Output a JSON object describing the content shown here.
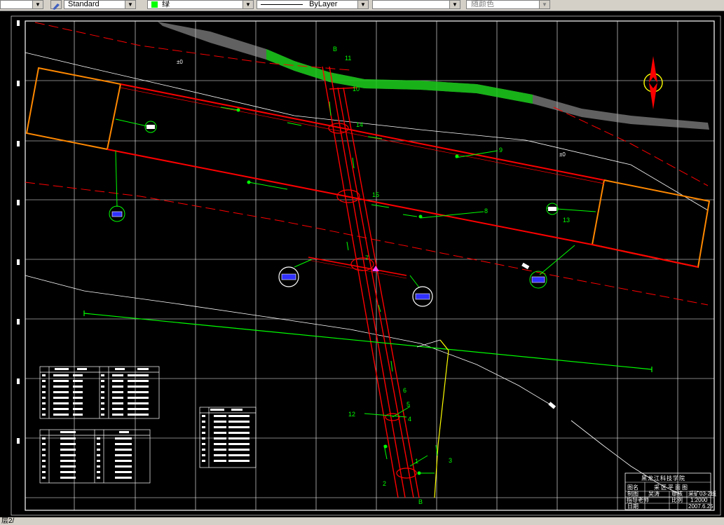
{
  "toolbar": {
    "text_style": "Standard",
    "color_value": "绿",
    "color_swatch": "#00ff00",
    "linetype_value": "ByLayer",
    "lineweight_value": "",
    "plotstyle_value": "随颜色"
  },
  "status": {
    "command_line": "层2/"
  },
  "drawing": {
    "background": "#000000",
    "colors": {
      "mine_line": "#ff0000",
      "annotation": "#00ff00",
      "aux": "#ffff00",
      "grid": "#ffffff",
      "contour": "#ffffff",
      "orange": "#ff8800"
    },
    "elevation_labels": [
      "±0",
      "±0"
    ],
    "point_labels": [
      "B",
      "11",
      "10",
      "14",
      "9",
      "15",
      "8",
      "13",
      "7",
      "6",
      "5",
      "4",
      "12",
      "1",
      "3",
      "2",
      "B"
    ],
    "title_block": {
      "school": "黑龙江科技学院",
      "label_drawing": "图名",
      "drawing_title": "采区平面图",
      "label_drawn": "制图",
      "drawn_by": "吴涛",
      "label_checked": "审核",
      "drawing_no": "采矿03-2班",
      "label_reviewer": "指导老师",
      "label_scale": "比例",
      "scale": "1:2000",
      "label_date": "日期",
      "date": "2007.6.25"
    }
  }
}
